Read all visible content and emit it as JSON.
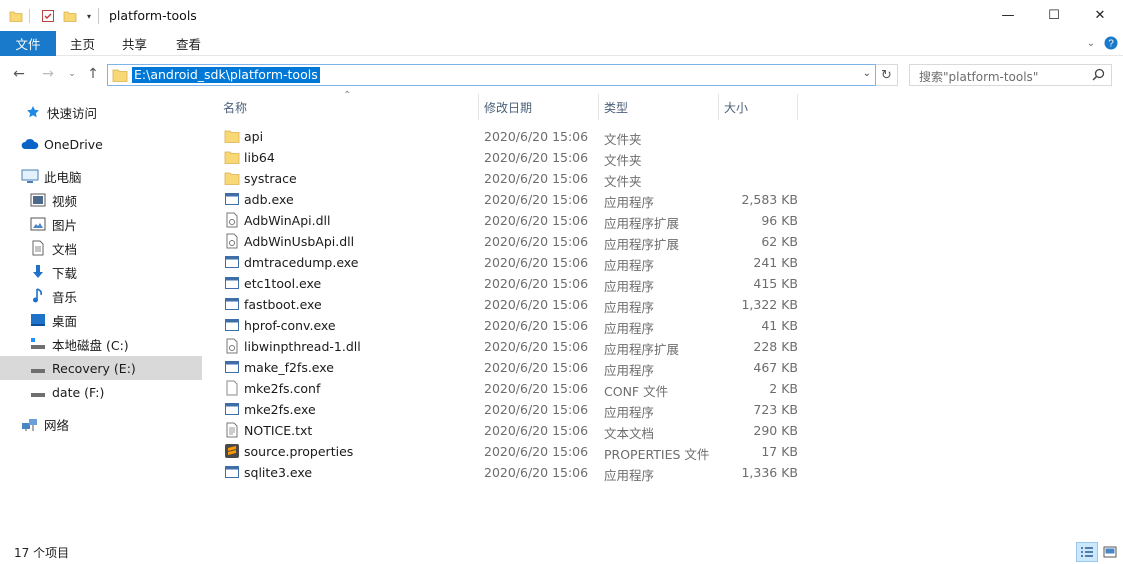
{
  "window": {
    "title": "platform-tools",
    "controls": {
      "minimize": "—",
      "maximize": "☐",
      "close": "✕"
    }
  },
  "ribbon": {
    "tabs": [
      "文件",
      "主页",
      "共享",
      "查看"
    ]
  },
  "nav": {
    "address": "E:\\android_sdk\\platform-tools",
    "search_placeholder": "搜索\"platform-tools\""
  },
  "sidebar": {
    "items": [
      {
        "label": "快速访问",
        "icon": "star-icon"
      },
      {
        "label": "OneDrive",
        "icon": "cloud-icon"
      },
      {
        "label": "此电脑",
        "icon": "computer-icon"
      },
      {
        "label": "视频",
        "icon": "video-icon"
      },
      {
        "label": "图片",
        "icon": "pictures-icon"
      },
      {
        "label": "文档",
        "icon": "document-icon"
      },
      {
        "label": "下载",
        "icon": "download-icon"
      },
      {
        "label": "音乐",
        "icon": "music-icon"
      },
      {
        "label": "桌面",
        "icon": "desktop-icon"
      },
      {
        "label": "本地磁盘 (C:)",
        "icon": "drive-icon"
      },
      {
        "label": "Recovery (E:)",
        "icon": "drive-icon"
      },
      {
        "label": "date (F:)",
        "icon": "drive-icon"
      },
      {
        "label": "网络",
        "icon": "network-icon"
      }
    ]
  },
  "list": {
    "columns": [
      "名称",
      "修改日期",
      "类型",
      "大小"
    ],
    "files": [
      {
        "name": "api",
        "date": "2020/6/20 15:06",
        "type": "文件夹",
        "size": "",
        "icon": "folder"
      },
      {
        "name": "lib64",
        "date": "2020/6/20 15:06",
        "type": "文件夹",
        "size": "",
        "icon": "folder"
      },
      {
        "name": "systrace",
        "date": "2020/6/20 15:06",
        "type": "文件夹",
        "size": "",
        "icon": "folder"
      },
      {
        "name": "adb.exe",
        "date": "2020/6/20 15:06",
        "type": "应用程序",
        "size": "2,583 KB",
        "icon": "exe"
      },
      {
        "name": "AdbWinApi.dll",
        "date": "2020/6/20 15:06",
        "type": "应用程序扩展",
        "size": "96 KB",
        "icon": "dll"
      },
      {
        "name": "AdbWinUsbApi.dll",
        "date": "2020/6/20 15:06",
        "type": "应用程序扩展",
        "size": "62 KB",
        "icon": "dll"
      },
      {
        "name": "dmtracedump.exe",
        "date": "2020/6/20 15:06",
        "type": "应用程序",
        "size": "241 KB",
        "icon": "exe"
      },
      {
        "name": "etc1tool.exe",
        "date": "2020/6/20 15:06",
        "type": "应用程序",
        "size": "415 KB",
        "icon": "exe"
      },
      {
        "name": "fastboot.exe",
        "date": "2020/6/20 15:06",
        "type": "应用程序",
        "size": "1,322 KB",
        "icon": "exe"
      },
      {
        "name": "hprof-conv.exe",
        "date": "2020/6/20 15:06",
        "type": "应用程序",
        "size": "41 KB",
        "icon": "exe"
      },
      {
        "name": "libwinpthread-1.dll",
        "date": "2020/6/20 15:06",
        "type": "应用程序扩展",
        "size": "228 KB",
        "icon": "dll"
      },
      {
        "name": "make_f2fs.exe",
        "date": "2020/6/20 15:06",
        "type": "应用程序",
        "size": "467 KB",
        "icon": "exe"
      },
      {
        "name": "mke2fs.conf",
        "date": "2020/6/20 15:06",
        "type": "CONF 文件",
        "size": "2 KB",
        "icon": "file"
      },
      {
        "name": "mke2fs.exe",
        "date": "2020/6/20 15:06",
        "type": "应用程序",
        "size": "723 KB",
        "icon": "exe"
      },
      {
        "name": "NOTICE.txt",
        "date": "2020/6/20 15:06",
        "type": "文本文档",
        "size": "290 KB",
        "icon": "txt"
      },
      {
        "name": "source.properties",
        "date": "2020/6/20 15:06",
        "type": "PROPERTIES 文件",
        "size": "17 KB",
        "icon": "sublime"
      },
      {
        "name": "sqlite3.exe",
        "date": "2020/6/20 15:06",
        "type": "应用程序",
        "size": "1,336 KB",
        "icon": "exe"
      }
    ]
  },
  "status": {
    "item_count": "17 个项目"
  },
  "colors": {
    "accent": "#1979ca",
    "selection": "#0078d7",
    "folder": "#f8d775"
  }
}
